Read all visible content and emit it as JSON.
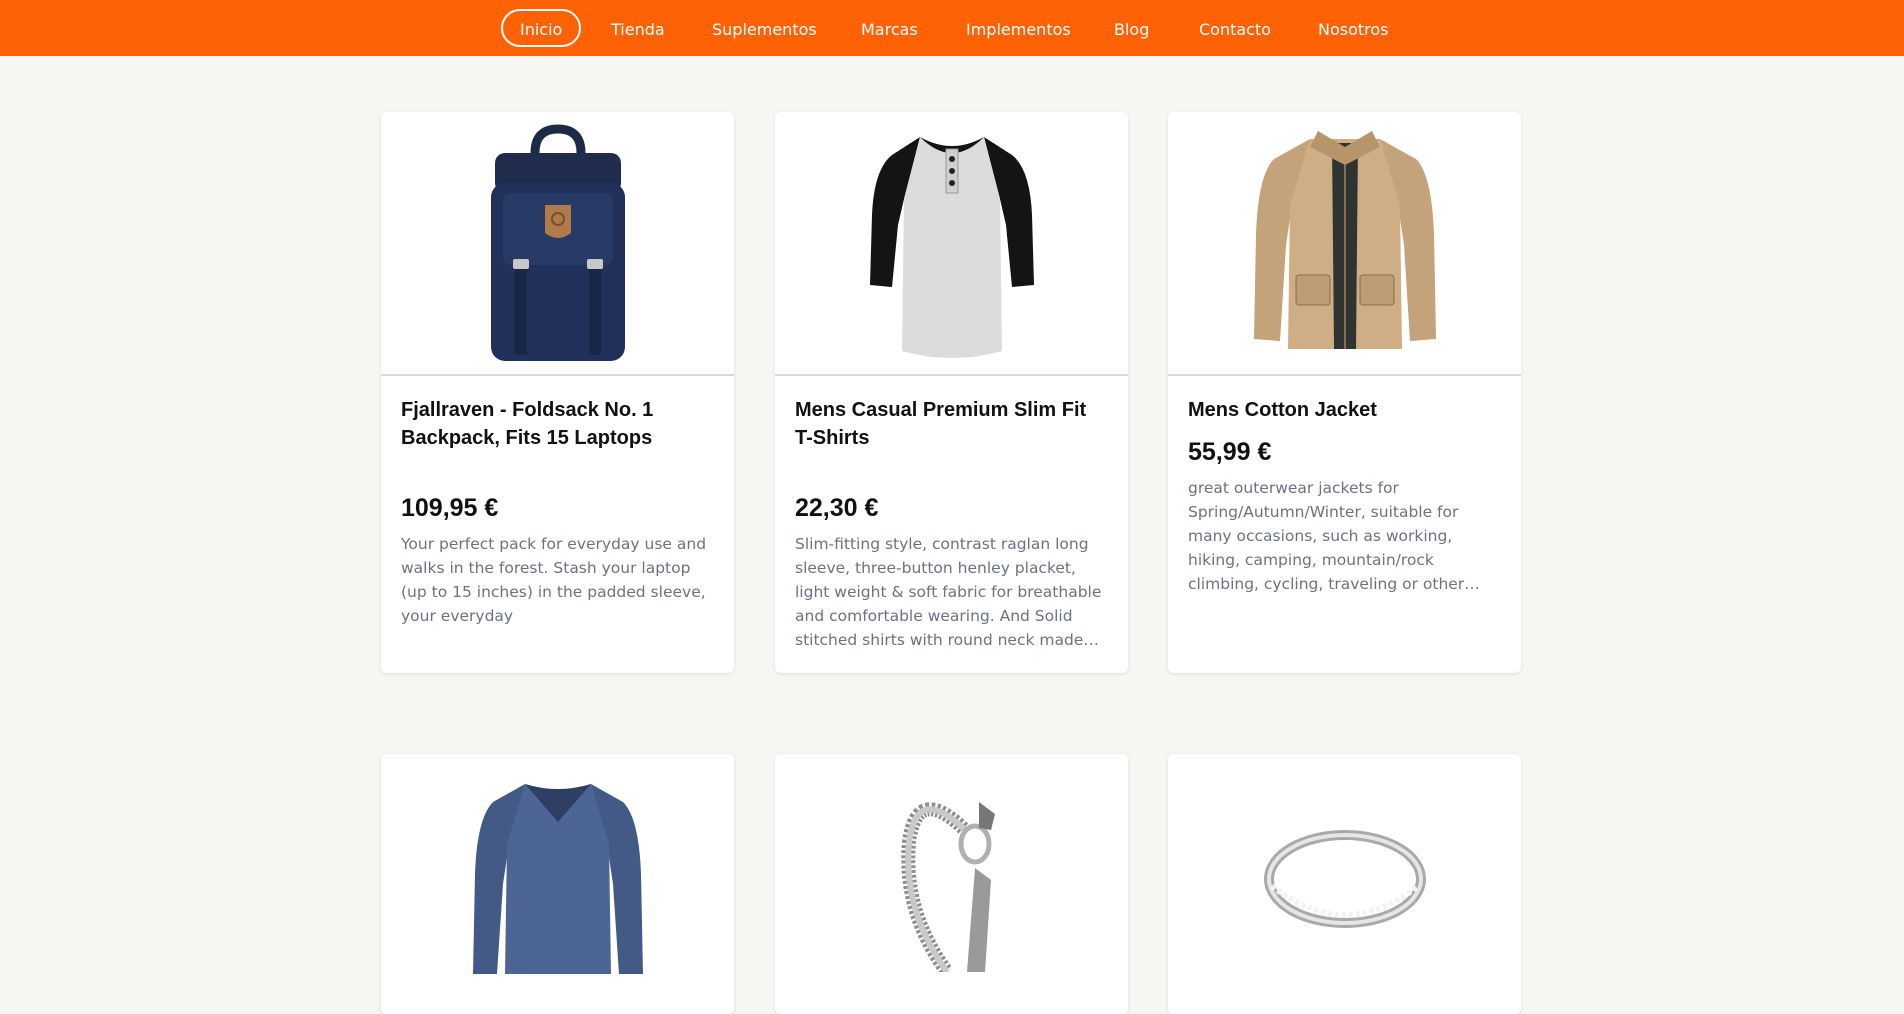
{
  "nav": {
    "items": [
      {
        "label": "Inicio",
        "active": true
      },
      {
        "label": "Tienda"
      },
      {
        "label": "Suplementos"
      },
      {
        "label": "Marcas"
      },
      {
        "label": "Implementos"
      },
      {
        "label": "Blog"
      },
      {
        "label": "Contacto"
      },
      {
        "label": "Nosotros"
      }
    ]
  },
  "products": [
    {
      "title": "Fjallraven - Foldsack No. 1 Backpack, Fits 15 Laptops",
      "price": "109,95 €",
      "description": "Your perfect pack for everyday use and walks in the forest. Stash your laptop (up to 15 inches) in the padded sleeve, your everyday",
      "image": "backpack"
    },
    {
      "title": "Mens Casual Premium Slim Fit T-Shirts",
      "price": "22,30 €",
      "description": "Slim-fitting style, contrast raglan long sleeve, three-button henley placket, light weight & soft fabric for breathable and comfortable wearing. And Solid stitched shirts with round neck made for durability and a great fit for casual fashion wear and diehard baseball fans.",
      "image": "henley-shirt"
    },
    {
      "title": "Mens Cotton Jacket",
      "price": "55,99 €",
      "description": "great outerwear jackets for Spring/Autumn/Winter, suitable for many occasions, such as working, hiking, camping, mountain/rock climbing, cycling, traveling or other outdoors. Good gift choice for you or your family member. A warm hearted love to Father, husband or son in this thanksgiving or Christmas Day.",
      "image": "jacket"
    },
    {
      "image": "long-sleeve-shirt"
    },
    {
      "image": "dragon-bracelet"
    },
    {
      "image": "ring"
    }
  ],
  "colors": {
    "brand": "#ff6105",
    "background": "#f8f6f2",
    "description_text": "#6b7280"
  }
}
